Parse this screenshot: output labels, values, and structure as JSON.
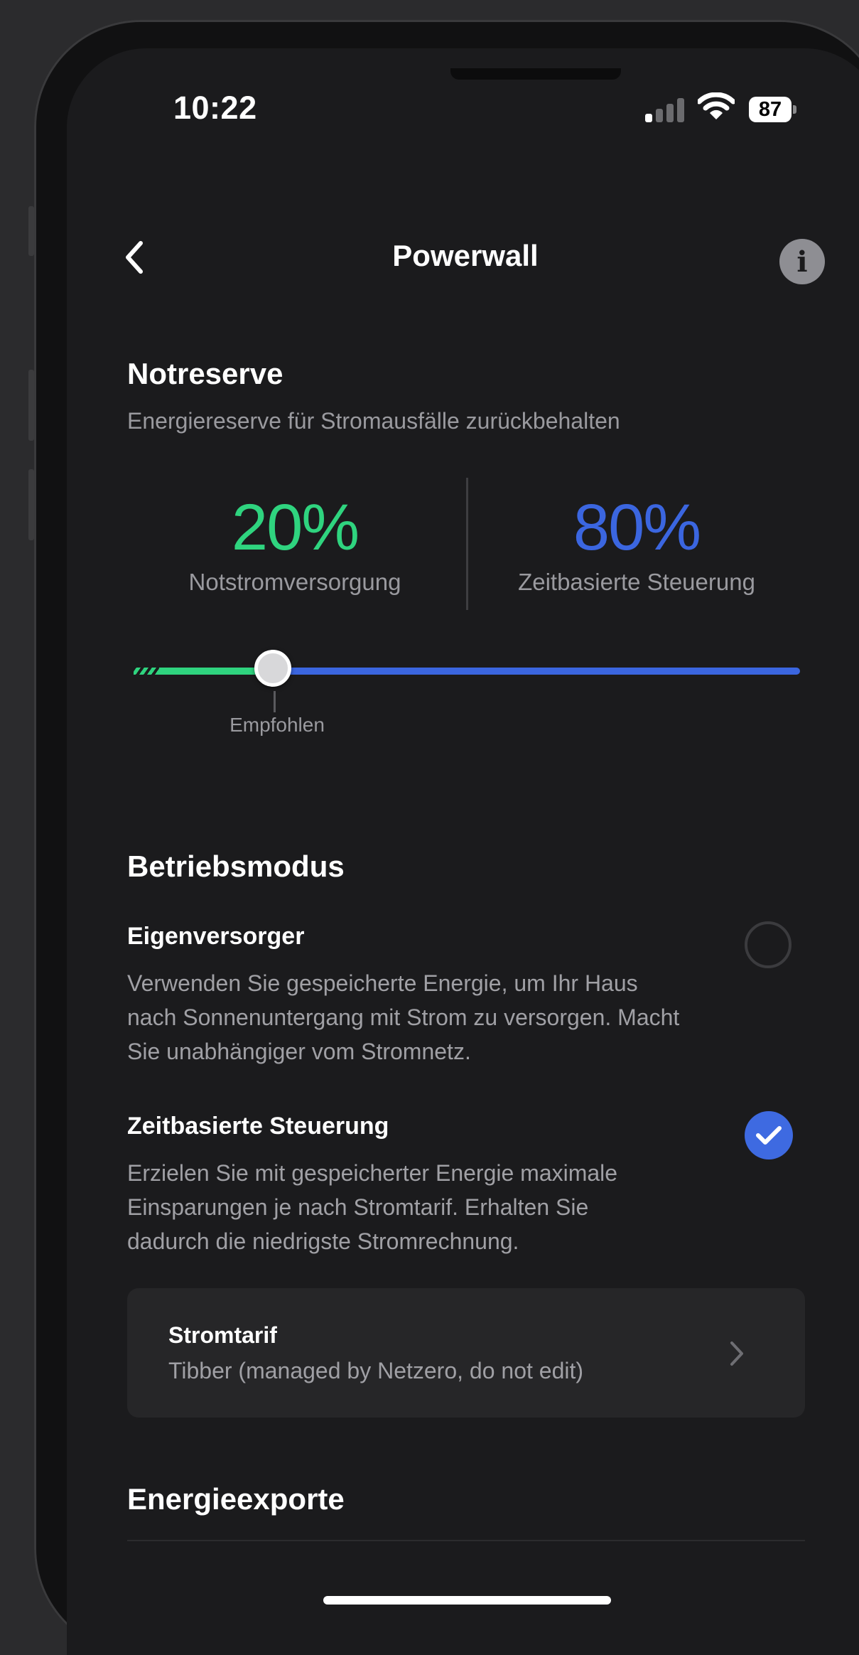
{
  "status_bar": {
    "time": "10:22",
    "battery": "87",
    "icons": [
      "cellular-signal-icon",
      "wifi-icon",
      "battery-icon"
    ]
  },
  "nav": {
    "title": "Powerwall",
    "back_icon": "chevron-left-icon",
    "info_icon": "info-icon",
    "info_glyph": "i"
  },
  "reserve": {
    "title": "Notreserve",
    "subtitle": "Energiereserve für Stromausfälle zurückbehalten",
    "backup": {
      "value": "20%",
      "label": "Notstromversorgung",
      "color": "#2fd47f"
    },
    "time_based": {
      "value": "80%",
      "label": "Zeitbasierte Steuerung",
      "color": "#3b66e0"
    },
    "slider": {
      "value_percent": 20,
      "recommended_label": "Empfohlen"
    }
  },
  "mode": {
    "title": "Betriebsmodus",
    "options": [
      {
        "title": "Eigenversorger",
        "lines": [
          "Verwenden Sie gespeicherte Energie, um Ihr Haus",
          "nach Sonnenuntergang mit Strom zu versorgen. Macht",
          "Sie unabhängiger vom Stromnetz."
        ],
        "selected": false
      },
      {
        "title": "Zeitbasierte Steuerung",
        "lines": [
          "Erzielen Sie mit gespeicherter Energie maximale",
          "Einsparungen je nach Stromtarif. Erhalten Sie",
          "dadurch die niedrigste Stromrechnung."
        ],
        "selected": true
      }
    ]
  },
  "tariff": {
    "title": "Stromtarif",
    "value": "Tibber (managed by Netzero, do not edit)"
  },
  "export": {
    "title": "Energieexporte"
  },
  "colors": {
    "background": "#1b1b1d",
    "card": "#262628",
    "accent_blue": "#3e6ae1",
    "accent_green": "#2fd47f"
  }
}
